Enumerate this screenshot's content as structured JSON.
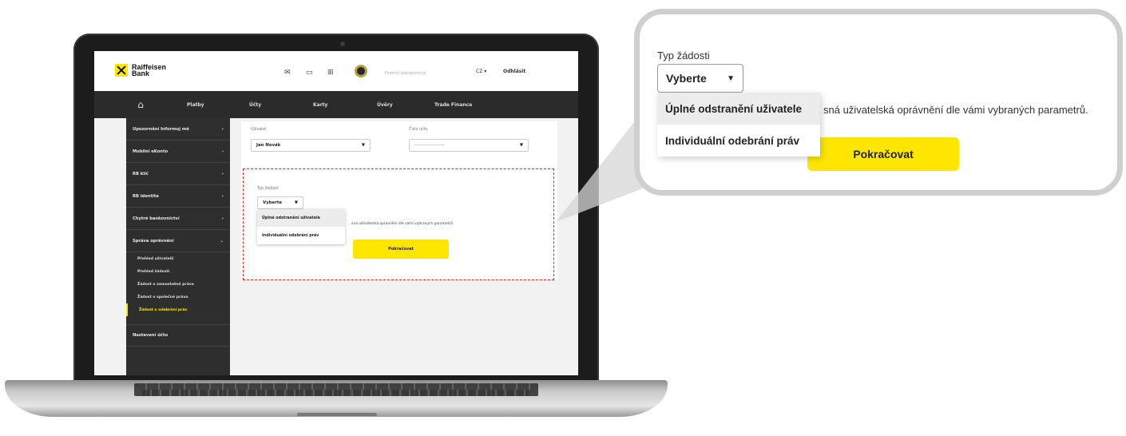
{
  "colors": {
    "brand_yellow": "#fee600",
    "dark_nav": "#2b2b2b",
    "highlight_dashed": "#e1251b"
  },
  "header": {
    "logo_text": "Raiffeisen\nBank",
    "icons": [
      "envelope-icon",
      "document-icon",
      "cart-icon"
    ],
    "selector_placeholder": "Firemní bankovnictví",
    "lang": "CZ ▾",
    "logout": "Odhlásit"
  },
  "nav": {
    "items": [
      "Platby",
      "Účty",
      "Karty",
      "Úvěry",
      "Trade Finance"
    ]
  },
  "sidebar": {
    "items": [
      {
        "label": "Upozornění Informuj mě",
        "chevron": "›"
      },
      {
        "label": "Mobilní eKonto",
        "chevron": "›"
      },
      {
        "label": "RB klíč",
        "chevron": "›"
      },
      {
        "label": "RB identita",
        "chevron": "›"
      },
      {
        "label": "Chytré bankovnictví",
        "chevron": "›"
      },
      {
        "label": "Správa oprávnění",
        "chevron": "⌄"
      }
    ],
    "subitems": [
      {
        "label": "Přehled uživatelů"
      },
      {
        "label": "Přehled žádostí"
      },
      {
        "label": "Žádost o samostatné práva"
      },
      {
        "label": "Žádost o společné práva"
      },
      {
        "label": "Žádost o odebrání práv"
      }
    ],
    "footer_item": "Nastavení účtu"
  },
  "form": {
    "user_label": "Uživatel",
    "user_value": "Jan Novák",
    "account_label": "Číslo účtu",
    "account_placeholder": "———————",
    "type_label": "Typ žádosti",
    "type_value": "Vyberte",
    "caret": "▼",
    "options": [
      "Úplné odstranění uživatele",
      "Individuální odebrání práv"
    ],
    "description": "...sná uživatelská oprávnění dle vámi vybraných parametrů.",
    "continue": "Pokračovat"
  },
  "callout": {
    "type_label": "Typ žádosti",
    "type_value": "Vyberte",
    "caret": "▼",
    "options": [
      "Úplné odstranění uživatele",
      "Individuální odebrání práv"
    ],
    "description": "sná uživatelská oprávnění dle vámi vybraných parametrů.",
    "continue": "Pokračovat"
  }
}
